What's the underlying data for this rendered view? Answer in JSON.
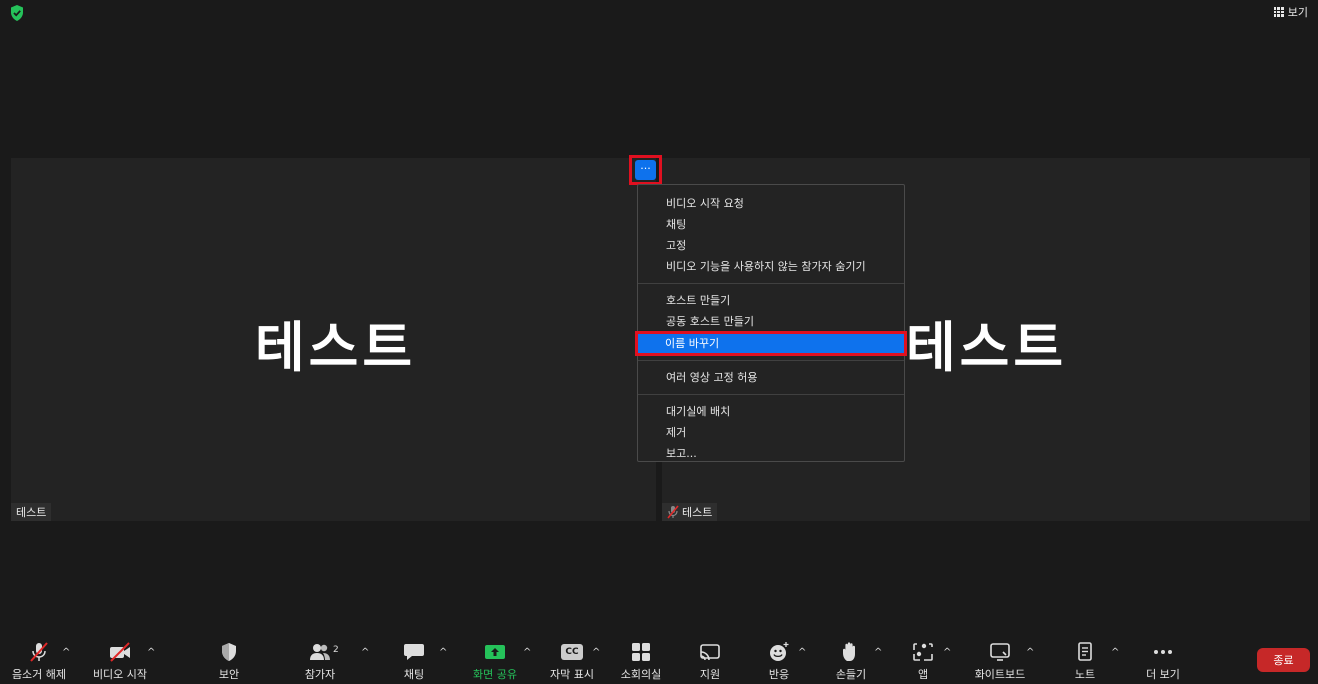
{
  "header": {
    "view_label": "보기"
  },
  "tiles": {
    "left": {
      "big_name": "테스트",
      "name_tag": "테스트"
    },
    "right": {
      "big_name": "테스트",
      "name_tag": "테스트"
    }
  },
  "more_button": {
    "label": "···"
  },
  "context_menu": {
    "group1": [
      "비디오 시작 요청",
      "채팅",
      "고정",
      "비디오 기능을 사용하지 않는 참가자 숨기기"
    ],
    "group2": [
      "호스트 만들기",
      "공동 호스트 만들기",
      "이름 바꾸기"
    ],
    "group3": [
      "여러 영상 고정 허용"
    ],
    "group4": [
      "대기실에 배치",
      "제거",
      "보고..."
    ]
  },
  "toolbar": {
    "unmute": "음소거 해제",
    "start_video": "비디오 시작",
    "security": "보안",
    "participants": "참가자",
    "participants_count": "2",
    "chat": "채팅",
    "share_screen": "화면 공유",
    "captions": "자막 표시",
    "captions_icon_text": "CC",
    "breakout": "소회의실",
    "support": "지원",
    "reactions": "반응",
    "raise_hand": "손들기",
    "apps": "앱",
    "whiteboard": "화이트보드",
    "notes": "노트",
    "more": "더 보기",
    "end": "종료"
  },
  "colors": {
    "accent_blue": "#0e72ed",
    "highlight_red": "#e01020",
    "share_green": "#25c25a",
    "end_red": "#c62828"
  }
}
